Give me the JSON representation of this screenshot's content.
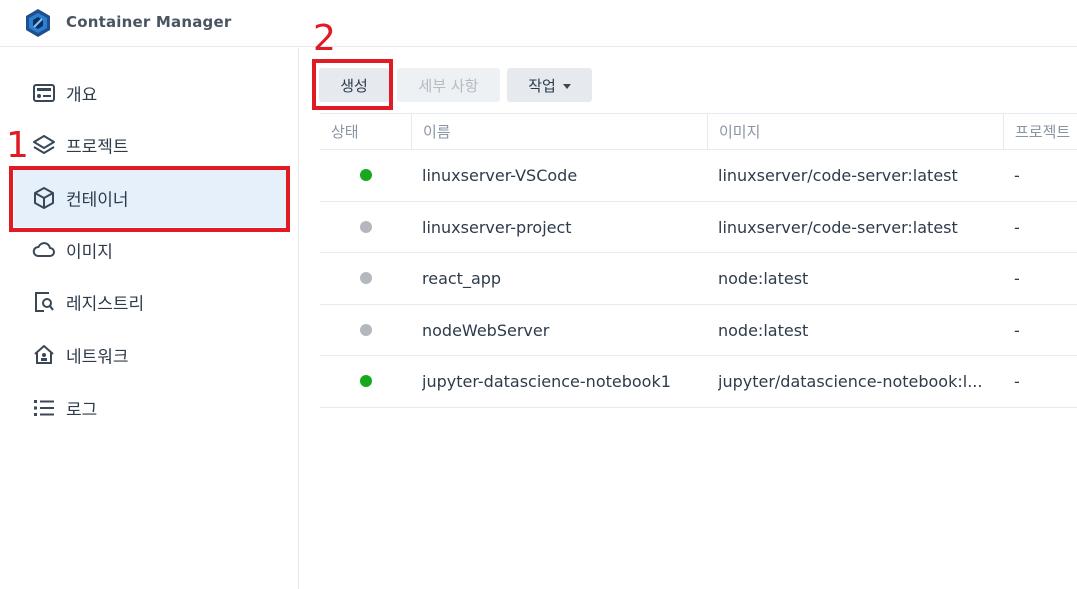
{
  "app": {
    "title": "Container Manager",
    "logo_icon": "container-manager-logo"
  },
  "sidebar": {
    "items": [
      {
        "label": "개요",
        "icon": "overview-icon",
        "active": false
      },
      {
        "label": "프로젝트",
        "icon": "layers-icon",
        "active": false
      },
      {
        "label": "컨테이너",
        "icon": "cube-icon",
        "active": true
      },
      {
        "label": "이미지",
        "icon": "cloud-icon",
        "active": false
      },
      {
        "label": "레지스트리",
        "icon": "registry-search-icon",
        "active": false
      },
      {
        "label": "네트워크",
        "icon": "network-house-icon",
        "active": false
      },
      {
        "label": "로그",
        "icon": "list-icon",
        "active": false
      }
    ]
  },
  "toolbar": {
    "create_label": "생성",
    "details_label": "세부 사항",
    "action_label": "작업"
  },
  "table": {
    "columns": [
      "상태",
      "이름",
      "이미지",
      "프로젝트"
    ],
    "rows": [
      {
        "status": "running",
        "name": "linuxserver-VSCode",
        "image": "linuxserver/code-server:latest",
        "project": "-"
      },
      {
        "status": "stopped",
        "name": "linuxserver-project",
        "image": "linuxserver/code-server:latest",
        "project": "-"
      },
      {
        "status": "stopped",
        "name": "react_app",
        "image": "node:latest",
        "project": "-"
      },
      {
        "status": "stopped",
        "name": "nodeWebServer",
        "image": "node:latest",
        "project": "-"
      },
      {
        "status": "running",
        "name": "jupyter-datascience-notebook1",
        "image": "jupyter/datascience-notebook:l...",
        "project": "-"
      }
    ]
  },
  "annotations": {
    "step1": "1",
    "step2": "2",
    "color": "#e01b24"
  },
  "colors": {
    "running": "#17a81e",
    "stopped": "#b4b8be",
    "active_bg": "#e5f0fb"
  }
}
